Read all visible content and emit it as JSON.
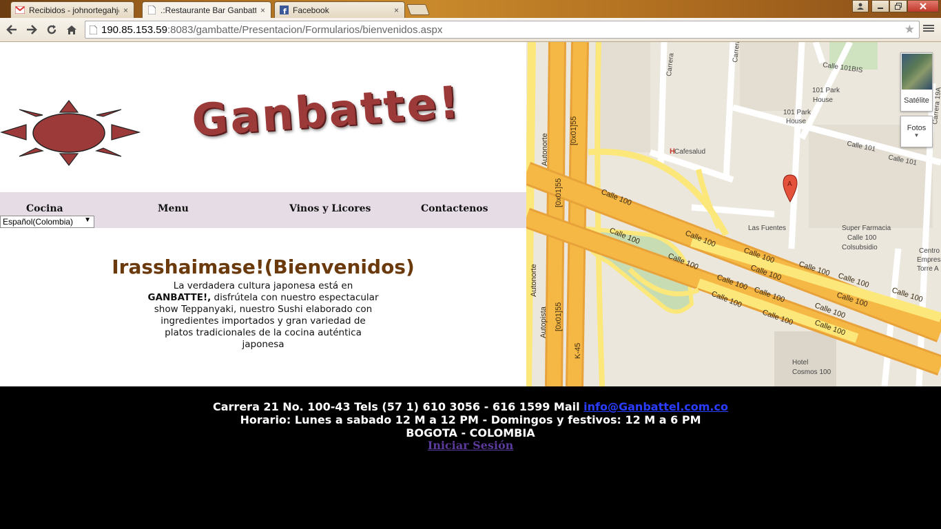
{
  "browser": {
    "tabs": [
      {
        "title": "Recibidos - johnortegahj@",
        "favicon": "gmail-icon"
      },
      {
        "title": ".:Restaurante Bar Ganbatte",
        "favicon": "page-icon"
      },
      {
        "title": "Facebook",
        "favicon": "facebook-icon"
      }
    ],
    "close_glyph": "×",
    "url_host": "190.85.153.59",
    "url_rest": ":8083/gambatte/Presentacion/Formularios/bienvenidos.aspx"
  },
  "header": {
    "brand": "Ganbatte!"
  },
  "nav": {
    "items": [
      "Cocina",
      "Menu",
      "Vinos y Licores",
      "Contactenos"
    ],
    "language_selected": "Español(Colombia)"
  },
  "welcome": {
    "title": "Irasshaimase!(Bienvenidos)",
    "line1": "La verdadera cultura japonesa está en",
    "brand_bold": "GANBATTE!,",
    "line2": " disfrútela con nuestro espectacular show Teppanyaki, nuestro Sushi elaborado con ingredientes importados y gran variedad de platos tradicionales de la cocina auténtica japonesa"
  },
  "map": {
    "controls": {
      "satellite": "Satélite",
      "photos": "Fotos"
    },
    "labels": {
      "calle_101bis": "Calle 101BIS",
      "park_house_1": "101 Park",
      "park_house_1b": "House",
      "park_house_2": "101 Park",
      "park_house_2b": "House",
      "cafesalud": "Cafesalud",
      "calle_101": "Calle 101",
      "las_fuentes": "Las Fuentes",
      "super_farmacia": "Super Farmacia",
      "calle_100_shop": "Calle 100",
      "colsubsidio": "Colsubsidio",
      "centro": "Centro",
      "empresarial": "Empresar",
      "torre": "Torre A",
      "hotel": "Hotel",
      "cosmos": "Cosmos 100",
      "carrera": "Carrera",
      "carrera_19a": "Carrera 19A",
      "autonorte": "Autonorte",
      "autopista": "Autopista",
      "ox01": "[0x01]55",
      "k45": "K-45",
      "calle_100": "Calle 100",
      "marker": "A"
    }
  },
  "footer": {
    "address": "Carrera 21 No. 100-43 Tels (57 1) 610 3056 - 616 1599 Mail ",
    "email": "info@Ganbattel.com.co",
    "hours": "Horario: Lunes a sabado 12 M a 12 PM - Domingos y festivos: 12 M a 6 PM",
    "city": "BOGOTA - COLOMBIA",
    "login": "Iniciar Sesión"
  },
  "colors": {
    "nav_bg": "#e6dce6",
    "title_brown": "#6b3a0c",
    "brand_red": "#9c3a3a",
    "road_orange": "#f6b845",
    "road_yellow": "#fbe77a"
  }
}
